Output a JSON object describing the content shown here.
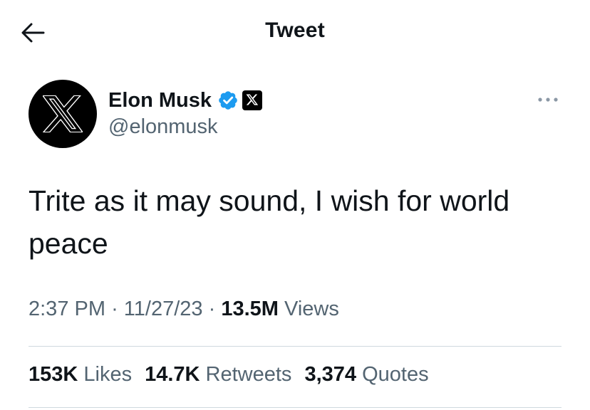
{
  "header": {
    "title": "Tweet",
    "back_icon": "arrow-left-icon"
  },
  "author": {
    "display_name": "Elon Musk",
    "handle": "@elonmusk",
    "verified_badge": "verified-badge-icon",
    "affiliate_badge": "x-logo-icon",
    "avatar": "x-logo-icon"
  },
  "tweet": {
    "text": "Trite as it may sound, I wish for world\npeace",
    "time": "2:37 PM",
    "date": "11/27/23",
    "separator": "·",
    "views_count": "13.5M",
    "views_label": "Views"
  },
  "stats": [
    {
      "count": "153K",
      "label": "Likes"
    },
    {
      "count": "14.7K",
      "label": "Retweets"
    },
    {
      "count": "3,374",
      "label": "Quotes"
    }
  ],
  "colors": {
    "text_primary": "#0f1419",
    "text_secondary": "#536471",
    "verified_blue": "#1d9bf0",
    "divider": "#cfd9de"
  }
}
